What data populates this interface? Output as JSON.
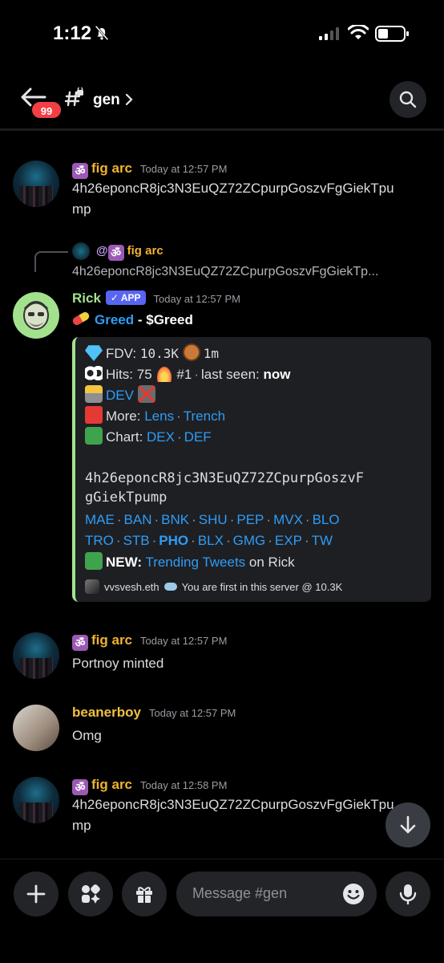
{
  "status": {
    "time": "1:12"
  },
  "header": {
    "badge": "99",
    "channel": "gen"
  },
  "messages": [
    {
      "user": "fig arc",
      "time": "Today at 12:57 PM",
      "text": "4h26eponcR8jc3N3EuQZ72ZCpurpGoszvFgGiekTpu",
      "text2": "mp"
    },
    {
      "reply_user": "@",
      "reply_name": "fig arc",
      "reply_text": "4h26eponcR8jc3N3EuQZ72ZCpurpGoszvFgGiekTp...",
      "user": "Rick",
      "app": "✓ APP",
      "time": "Today at 12:57 PM",
      "title_link": "Greed",
      "title_sep": " - ",
      "title_ticker": "$Greed"
    },
    {
      "user": "fig arc",
      "time": "Today at 12:57 PM",
      "text": "Portnoy minted"
    },
    {
      "user": "beanerboy",
      "time": "Today at 12:57 PM",
      "text": "Omg"
    },
    {
      "user": "fig arc",
      "time": "Today at 12:58 PM",
      "text": "4h26eponcR8jc3N3EuQZ72ZCpurpGoszvFgGiekTpu",
      "text2": "mp"
    }
  ],
  "embed": {
    "fdv_label": "FDV:",
    "fdv_value": "10.3K",
    "age": "1m",
    "hits_label": "Hits:",
    "hits_value": "75",
    "rank": "#1",
    "seen_label": "last seen:",
    "seen_value": "now",
    "dev": "DEV",
    "more_label": "More:",
    "more_links": [
      "Lens",
      "Trench"
    ],
    "chart_label": "Chart:",
    "chart_links": [
      "DEX",
      "DEF"
    ],
    "ca_line1": "4h26eponcR8jc3N3EuQZ72ZCpurpGoszvF",
    "ca_line2": "gGiekTpump",
    "links_row1": [
      "MAE",
      "BAN",
      "BNK",
      "SHU",
      "PEP",
      "MVX",
      "BLO"
    ],
    "links_row2": [
      "TRO",
      "STB",
      "PHO",
      "BLX",
      "GMG",
      "EXP",
      "TW"
    ],
    "new_label": "NEW:",
    "new_link": "Trending Tweets",
    "new_suffix": "on Rick",
    "footer_user": "vvsvesh.eth",
    "footer_text": "You are first in this server @ 10.3K"
  },
  "composer": {
    "placeholder": "Message #gen"
  },
  "colors": {
    "link": "#2f9cf5",
    "embed_bar": "#a3e28d",
    "badge": "#f23f43",
    "app_tag": "#5865f2"
  }
}
